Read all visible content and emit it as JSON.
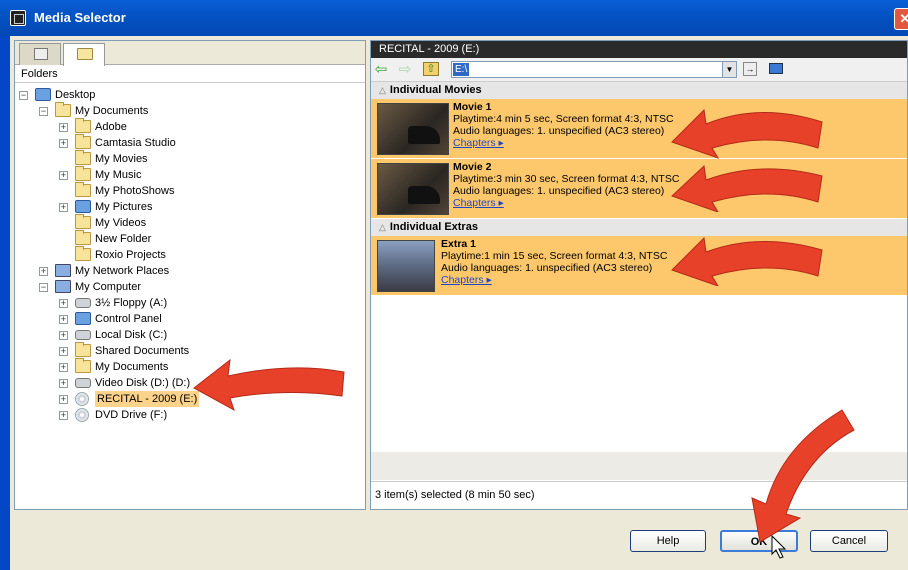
{
  "window": {
    "title": "Media Selector",
    "close_glyph": "✕"
  },
  "left_pane": {
    "folders_label": "Folders",
    "tree": [
      {
        "label": "Desktop",
        "level": 0,
        "expander": "−",
        "icon": "desktop-icon"
      },
      {
        "label": "My Documents",
        "level": 1,
        "expander": "−",
        "icon": "folder-icon"
      },
      {
        "label": "Adobe",
        "level": 2,
        "expander": "+",
        "icon": "folder-icon"
      },
      {
        "label": "Camtasia Studio",
        "level": 2,
        "expander": "+",
        "icon": "folder-icon"
      },
      {
        "label": "My Movies",
        "level": 2,
        "expander": "",
        "icon": "folder-icon"
      },
      {
        "label": "My Music",
        "level": 2,
        "expander": "+",
        "icon": "music-folder-icon"
      },
      {
        "label": "My PhotoShows",
        "level": 2,
        "expander": "",
        "icon": "folder-icon"
      },
      {
        "label": "My Pictures",
        "level": 2,
        "expander": "+",
        "icon": "pictures-folder-icon"
      },
      {
        "label": "My Videos",
        "level": 2,
        "expander": "",
        "icon": "folder-icon"
      },
      {
        "label": "New Folder",
        "level": 2,
        "expander": "",
        "icon": "folder-icon"
      },
      {
        "label": "Roxio Projects",
        "level": 2,
        "expander": "",
        "icon": "folder-icon"
      },
      {
        "label": "My Network Places",
        "level": 1,
        "expander": "+",
        "icon": "network-icon"
      },
      {
        "label": "My Computer",
        "level": 1,
        "expander": "−",
        "icon": "computer-icon"
      },
      {
        "label": "3½ Floppy (A:)",
        "level": 2,
        "expander": "+",
        "icon": "floppy-icon"
      },
      {
        "label": "Control Panel",
        "level": 2,
        "expander": "+",
        "icon": "control-panel-icon"
      },
      {
        "label": "Local Disk (C:)",
        "level": 2,
        "expander": "+",
        "icon": "drive-icon"
      },
      {
        "label": "Shared Documents",
        "level": 2,
        "expander": "+",
        "icon": "folder-icon"
      },
      {
        "label": "My Documents",
        "level": 2,
        "expander": "+",
        "icon": "folder-icon"
      },
      {
        "label": "Video Disk (D:) (D:)",
        "level": 2,
        "expander": "+",
        "icon": "drive-icon"
      },
      {
        "label": "RECITAL - 2009 (E:)",
        "level": 2,
        "expander": "+",
        "icon": "dvd-icon",
        "selected": true
      },
      {
        "label": "DVD Drive (F:)",
        "level": 2,
        "expander": "+",
        "icon": "dvd-icon"
      }
    ]
  },
  "right_pane": {
    "header": "RECITAL - 2009 (E:)",
    "address_value": "E:\\",
    "sections": [
      {
        "title": "Individual Movies",
        "items": [
          {
            "name": "Movie 1",
            "playtime": "Playtime:4 min 5 sec, Screen format 4:3, NTSC",
            "audio": "Audio languages: 1. unspecified (AC3 stereo)",
            "link": "Chapters ▸"
          },
          {
            "name": "Movie 2",
            "playtime": "Playtime:3 min 30 sec, Screen format 4:3, NTSC",
            "audio": "Audio languages: 1. unspecified (AC3 stereo)",
            "link": "Chapters ▸"
          }
        ]
      },
      {
        "title": "Individual Extras",
        "items": [
          {
            "name": "Extra 1",
            "playtime": "Playtime:1 min 15 sec, Screen format 4:3, NTSC",
            "audio": "Audio languages: 1. unspecified (AC3 stereo)",
            "link": "Chapters ▸"
          }
        ]
      }
    ],
    "status": "3 item(s) selected (8 min 50 sec)"
  },
  "buttons": {
    "help": "Help",
    "ok": "OK",
    "cancel": "Cancel"
  },
  "colors": {
    "title_bar": "#0453c4",
    "item_highlight": "#fcc86b",
    "arrow": "#e8412a"
  }
}
